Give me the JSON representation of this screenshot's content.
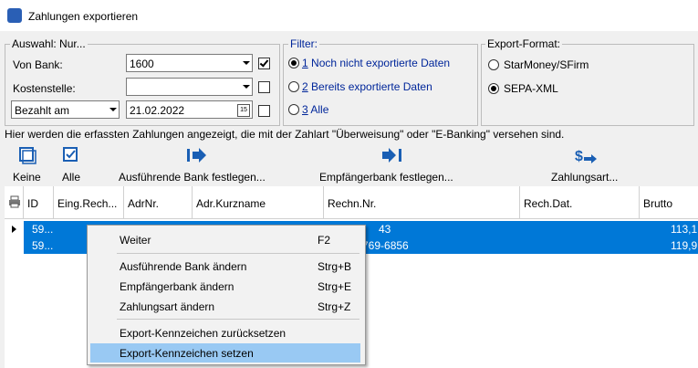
{
  "window": {
    "title": "Zahlungen exportieren"
  },
  "auswahl": {
    "legend": "Auswahl: Nur...",
    "von_bank_label": "Von Bank:",
    "von_bank_value": "1600",
    "kostenstelle_label": "Kostenstelle:",
    "kostenstelle_value": "",
    "bezahlt_label": "Bezahlt am",
    "date_value": "21.02.2022",
    "date_icon_text": "15",
    "von_bank_checked": true,
    "kostenstelle_checked": false,
    "date_checked": false
  },
  "filter": {
    "legend": "Filter:",
    "options": [
      {
        "key": "1",
        "label": " Noch nicht exportierte Daten",
        "selected": true
      },
      {
        "key": "2",
        "label": " Bereits exportierte Daten",
        "selected": false
      },
      {
        "key": "3",
        "label": " Alle",
        "selected": false
      }
    ]
  },
  "export_format": {
    "legend": "Export-Format:",
    "options": [
      {
        "label": "StarMoney/SFirm",
        "selected": false
      },
      {
        "label": "SEPA-XML",
        "selected": true
      }
    ]
  },
  "info_text": "Hier werden die erfassten Zahlungen angezeigt, die mit der Zahlart \"Überweisung\" oder \"E-Banking\" versehen sind.",
  "toolbar": {
    "keine": "Keine",
    "alle": "Alle",
    "ausfuehrende_bank": "Ausführende Bank festlegen...",
    "empfaengerbank": "Empfängerbank festlegen...",
    "zahlungsart": "Zahlungsart..."
  },
  "grid": {
    "columns": [
      "ID",
      "Eing.Rech...",
      "AdrNr.",
      "Adr.Kurzname",
      "Rechn.Nr.",
      "Rech.Dat.",
      "Brutto"
    ],
    "rows": [
      {
        "id": "59...",
        "rechn": "43",
        "brutto": "113,1"
      },
      {
        "id": "59...",
        "rechn": "769-6856",
        "brutto": "119,9"
      }
    ]
  },
  "context_menu": {
    "items": [
      {
        "label": "Weiter",
        "shortcut": "F2"
      },
      {
        "label": "Ausführende Bank ändern",
        "shortcut": "Strg+B"
      },
      {
        "label": "Empfängerbank ändern",
        "shortcut": "Strg+E"
      },
      {
        "label": "Zahlungsart ändern",
        "shortcut": "Strg+Z"
      },
      {
        "label": "Export-Kennzeichen zurücksetzen",
        "shortcut": ""
      },
      {
        "label": "Export-Kennzeichen setzen",
        "shortcut": ""
      }
    ]
  },
  "colors": {
    "selection": "#0078d7",
    "menu_highlight": "#99c9f3",
    "filter_text": "#00269a",
    "icon_blue": "#1a5fb4"
  }
}
